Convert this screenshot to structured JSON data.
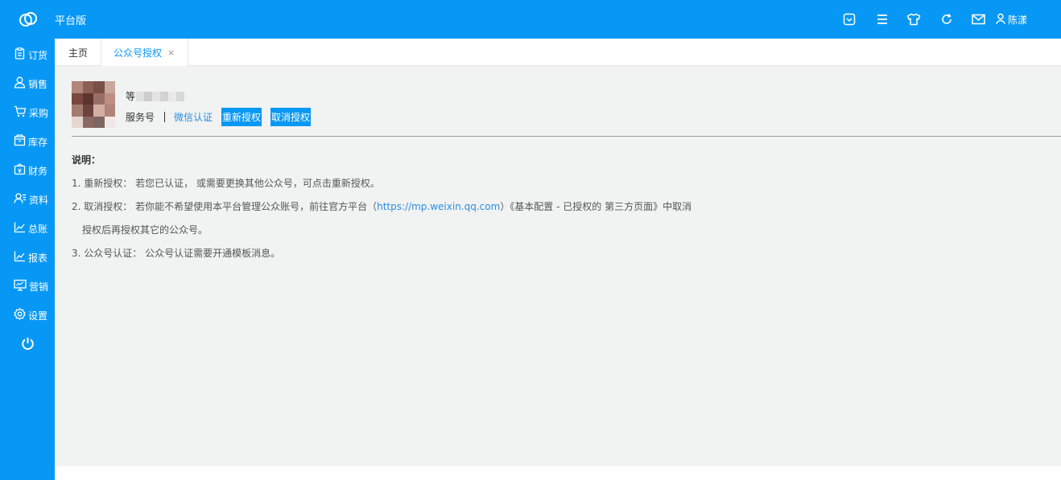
{
  "header": {
    "brand": "平台版",
    "user_name": "陈漾",
    "icons": [
      "cloud-logo-icon",
      "dropdown-box-icon",
      "menu-list-icon",
      "shirt-icon",
      "refresh-icon",
      "mail-icon",
      "user-icon"
    ],
    "color": "#0798f5"
  },
  "sidebar": {
    "items": [
      {
        "label": "订货",
        "icon": "clipboard-icon"
      },
      {
        "label": "销售",
        "icon": "person-icon"
      },
      {
        "label": "采购",
        "icon": "cart-icon"
      },
      {
        "label": "库存",
        "icon": "box-icon"
      },
      {
        "label": "财务",
        "icon": "wallet-icon"
      },
      {
        "label": "资料",
        "icon": "contacts-icon"
      },
      {
        "label": "总账",
        "icon": "chart-icon"
      },
      {
        "label": "报表",
        "icon": "chart-icon"
      },
      {
        "label": "营销",
        "icon": "monitor-icon"
      },
      {
        "label": "设置",
        "icon": "gear-icon"
      }
    ],
    "power_icon": "power-icon"
  },
  "tabs": {
    "home": "主页",
    "active": "公众号授权",
    "close": "×"
  },
  "account": {
    "name": "等",
    "type": "服务号",
    "verify_link": "微信认证",
    "reauth_button": "重新授权",
    "cancel_button": "取消授权"
  },
  "notes": {
    "title": "说明：",
    "item1": "1. 重新授权： 若您已认证， 或需要更换其他公众号，可点击重新授权。",
    "item2_prefix": "2. 取消授权： 若你能不希望使用本平台管理公众账号，前往官方平台（",
    "item2_link": "https://mp.weixin.qq.com",
    "item2_suffix": "）《基本配置 - 已授权的 第三方页面》中取消",
    "item2_cont": "授权后再授权其它的公众号。",
    "item3": "3. 公众号认证： 公众号认证需要开通模板消息。"
  }
}
